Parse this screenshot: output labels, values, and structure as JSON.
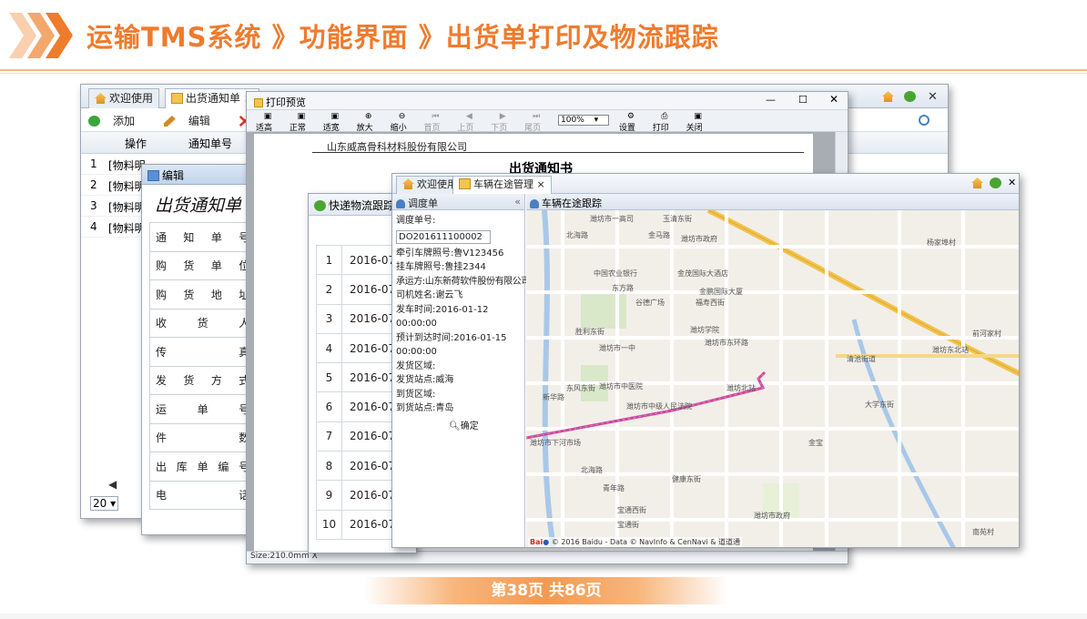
{
  "header": {
    "title": "运输TMS系统 》功能界面 》出货单打印及物流跟踪",
    "page_indicator": "第38页  共86页"
  },
  "colors": {
    "accent": "#ef7b2d",
    "tab_bg": "#e9eef5",
    "route": "#d4459b"
  },
  "main_window": {
    "tabs": [
      "欢迎使用",
      "出货通知单 ×"
    ],
    "toolbar": [
      "添加",
      "编辑",
      "删除"
    ],
    "columns": [
      "操作",
      "通知单号"
    ],
    "rows": [
      {
        "no": "1",
        "name": "[物料明"
      },
      {
        "no": "2",
        "name": "[物料明"
      },
      {
        "no": "3",
        "name": "[物料明"
      },
      {
        "no": "4",
        "name": "[物料明"
      }
    ],
    "pager_size": "20",
    "nav_icons": [
      "home-icon",
      "leaf-icon",
      "close-icon"
    ]
  },
  "edit_dialog": {
    "title": "编辑",
    "form_title": "出货通知单",
    "fields": [
      "通知单号",
      "购货单位",
      "购货地址",
      "收货人",
      "传真",
      "发货方式",
      "运单号",
      "件数",
      "出库单编号",
      "电话"
    ]
  },
  "print_window": {
    "title": "打印预览",
    "tools": [
      "适高",
      "正常",
      "适宽",
      "放大",
      "缩小",
      "首页",
      "上页",
      "下页",
      "尾页",
      "设置",
      "打印",
      "关闭"
    ],
    "zoom": "100%",
    "company": "山东威高骨科材料股份有限公司",
    "doc_title": "出货通知书",
    "status": "Size:210.0mm X"
  },
  "express_window": {
    "title": "快递物流跟踪",
    "rows": [
      {
        "no": "1",
        "date": "2016-07-"
      },
      {
        "no": "2",
        "date": "2016-07-"
      },
      {
        "no": "3",
        "date": "2016-07-"
      },
      {
        "no": "4",
        "date": "2016-07-"
      },
      {
        "no": "5",
        "date": "2016-07-"
      },
      {
        "no": "6",
        "date": "2016-07-"
      },
      {
        "no": "7",
        "date": "2016-07-"
      },
      {
        "no": "8",
        "date": "2016-07-"
      },
      {
        "no": "9",
        "date": "2016-07-"
      },
      {
        "no": "10",
        "date": "2016-07-"
      }
    ]
  },
  "vehicle_window": {
    "tabs": [
      "欢迎使用",
      "车辆在途管理 ×"
    ],
    "left_title": "调度单",
    "right_title": "车辆在途跟踪",
    "dispatch_label": "调度单号:",
    "dispatch_no": "DO201611100002",
    "info": [
      "牵引车牌照号:鲁V123456",
      "挂车牌照号:鲁挂2344",
      "承运方:山东新荷软件股份有限公司",
      "司机姓名:谢云飞",
      "发车时间:2016-01-12 00:00:00",
      "预计到达时间:2016-01-15",
      "00:00:00",
      "发货区域:",
      "发货站点:威海",
      "到货区域:",
      "到货站点:青岛"
    ],
    "confirm": "确定",
    "map_labels": [
      "潍坊市一高司",
      "北海路",
      "金马路",
      "潍坊市政府",
      "玉清东街",
      "东方路",
      "中国农业银行",
      "金茂国际大酒店",
      "金鹏国际大厦",
      "谷德广场",
      "潍坊市一中",
      "潍坊学院",
      "潍坊北站",
      "新华路",
      "潍坊市中医院",
      "潍坊市中级人民法院",
      "清池街道",
      "潍坊东北站",
      "东风东街",
      "福寿西街",
      "胜利东街",
      "潍坊市东环路",
      "健康东街",
      "大学东街",
      "潍坊市下河市场",
      "宝通街",
      "北海路",
      "青年路",
      "杨家埠村",
      "南苑村",
      "前河家村",
      "金宝",
      "潍坊市政府",
      "宝通西街"
    ],
    "map_footer": "© 2016 Baidu - Data © NavInfo & CenNavi & 道道通"
  }
}
